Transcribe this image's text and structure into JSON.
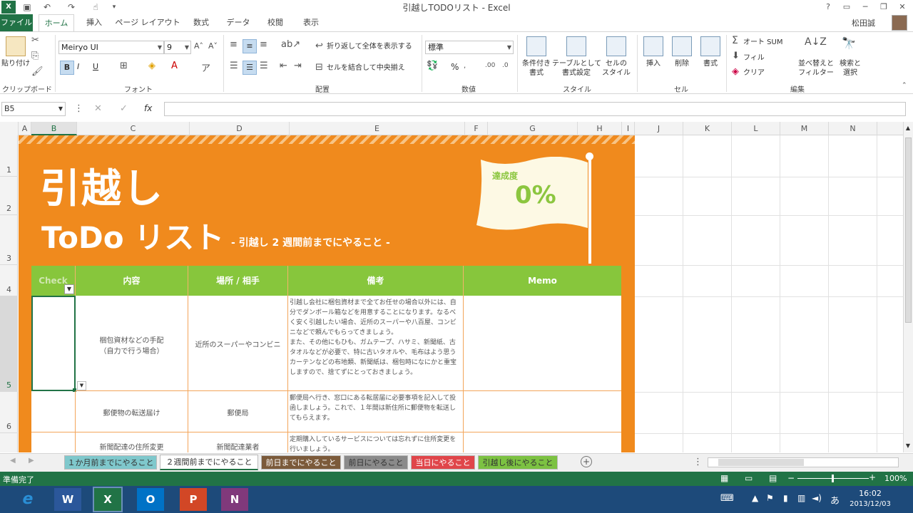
{
  "window": {
    "title": "引越しTODOリスト - Excel",
    "user": "松田誠",
    "help": "?"
  },
  "tabs": [
    {
      "label": "ファイル"
    },
    {
      "label": "ホーム"
    },
    {
      "label": "挿入"
    },
    {
      "label": "ページ レイアウト"
    },
    {
      "label": "数式"
    },
    {
      "label": "データ"
    },
    {
      "label": "校閲"
    },
    {
      "label": "表示"
    }
  ],
  "ribbon": {
    "clipboard": {
      "label": "クリップボード",
      "paste": "貼り付け"
    },
    "font": {
      "label": "フォント",
      "name": "Meiryo UI",
      "size": "9",
      "bold": "B",
      "italic": "I",
      "underline": "U"
    },
    "alignment": {
      "label": "配置",
      "wrap": "折り返して全体を表示する",
      "merge": "セルを結合して中央揃え"
    },
    "number": {
      "label": "数値",
      "format": "標準",
      "percent": "%"
    },
    "styles": {
      "label": "スタイル",
      "cond_1": "条件付き",
      "cond_2": "書式",
      "table_1": "テーブルとして",
      "table_2": "書式設定",
      "cell_1": "セルの",
      "cell_2": "スタイル"
    },
    "cells": {
      "label": "セル",
      "insert": "挿入",
      "delete": "削除",
      "format": "書式"
    },
    "editing": {
      "label": "編集",
      "autosum": "オート SUM",
      "fill": "フィル",
      "clear": "クリア",
      "sort_1": "並べ替えと",
      "sort_2": "フィルター",
      "find_1": "検索と",
      "find_2": "選択"
    }
  },
  "formula_bar": {
    "name_box": "B5",
    "fx": "fx",
    "value": ""
  },
  "columns": [
    "A",
    "B",
    "C",
    "D",
    "E",
    "F",
    "G",
    "H",
    "I",
    "J",
    "K",
    "L",
    "M",
    "N"
  ],
  "rows": [
    "1",
    "2",
    "3",
    "4",
    "5",
    "6"
  ],
  "sheet": {
    "title_line1": "引越し",
    "title_line2": "ToDo リスト",
    "subtitle": "- 引越し 2 週間前までにやること -",
    "flag_label": "達成度",
    "flag_value": "0%",
    "table_headers": [
      "Check",
      "内容",
      "場所 / 相手",
      "備考",
      "Memo"
    ],
    "table_rows": [
      {
        "content": "梱包資材などの手配\n（自力で行う場合）",
        "place": "近所のスーパーやコンビニ",
        "note": "引越し会社に梱包資材まで全てお任せの場合以外には、自分でダンボール箱などを用意することになります。なるべく安く引越したい場合、近所のスーパーや八百屋、コンビニなどで頼んでもらってきましょう。\nまた、その他にもひも、ガムテープ、ハサミ、新聞紙、古タオルなどが必要で、特に古いタオルや、毛布はよう思うカーテンなどの布地類、新聞紙は、梱包時になにかと重宝しますので、捨てずにとっておきましょう。",
        "memo": ""
      },
      {
        "content": "郵便物の転送届け",
        "place": "郵便局",
        "note": "郵便局へ行き、窓口にある転居届に必要事項を記入して投函しましょう。これで、１年間は新住所に郵便物を転送してもらえます。",
        "memo": ""
      },
      {
        "content": "新聞配達の住所変更",
        "place": "新聞配達業者",
        "note": "定期購入しているサービスについては忘れずに住所変更を行いましょう。",
        "memo": ""
      }
    ]
  },
  "sheet_tabs": [
    {
      "label": "１か月前までにやること",
      "color": "#7fc8cc"
    },
    {
      "label": "２週間前までにやること",
      "color": "#f5e6c8"
    },
    {
      "label": "前日までにやること",
      "color": "#7b5a3a"
    },
    {
      "label": "前日にやること",
      "color": "#8a8a8a"
    },
    {
      "label": "当日にやること",
      "color": "#e0454a"
    },
    {
      "label": "引越し後にやること",
      "color": "#7cc242"
    }
  ],
  "status": {
    "ready": "準備完了",
    "zoom": "100%"
  },
  "taskbar": {
    "apps": [
      {
        "label": "e",
        "color": "#2a8fd6"
      },
      {
        "label": "W",
        "color": "#2b579a"
      },
      {
        "label": "X",
        "color": "#217346"
      },
      {
        "label": "O",
        "color": "#0072c6"
      },
      {
        "label": "P",
        "color": "#d24726"
      },
      {
        "label": "N",
        "color": "#80397b"
      }
    ],
    "time": "16:02",
    "date": "2013/12/03",
    "ime": "あ"
  }
}
